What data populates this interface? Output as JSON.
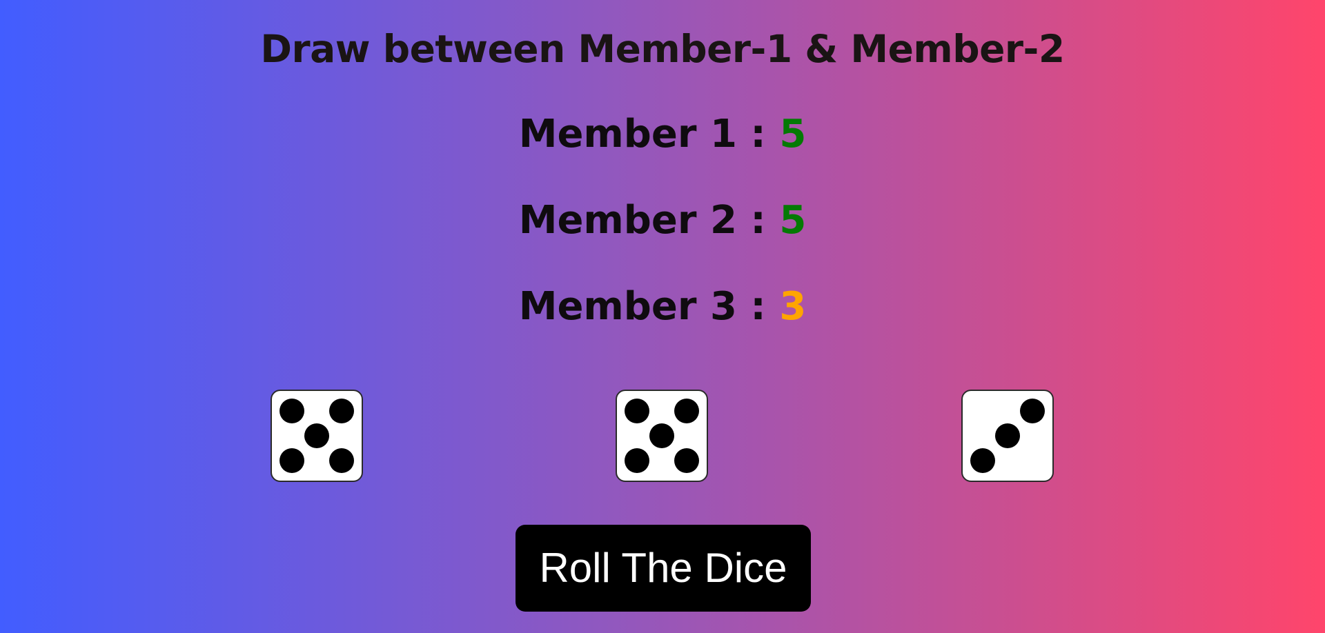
{
  "heading": "Draw between Member-1 & Member-2",
  "members": [
    {
      "label": "Member 1",
      "separator": " : ",
      "score": "5"
    },
    {
      "label": "Member 2",
      "separator": " : ",
      "score": "5"
    },
    {
      "label": "Member 3",
      "separator": " : ",
      "score": "3"
    }
  ],
  "dice": [
    {
      "value": 5
    },
    {
      "value": 5
    },
    {
      "value": 3
    }
  ],
  "button": {
    "label": "Roll The Dice"
  },
  "colors": {
    "winner_score": "#047A04",
    "loser_score": "#FFA500",
    "gradient_start": "#425DFF",
    "gradient_end": "#FF456B",
    "button_bg": "#000000",
    "button_text": "#FFFFFF"
  }
}
